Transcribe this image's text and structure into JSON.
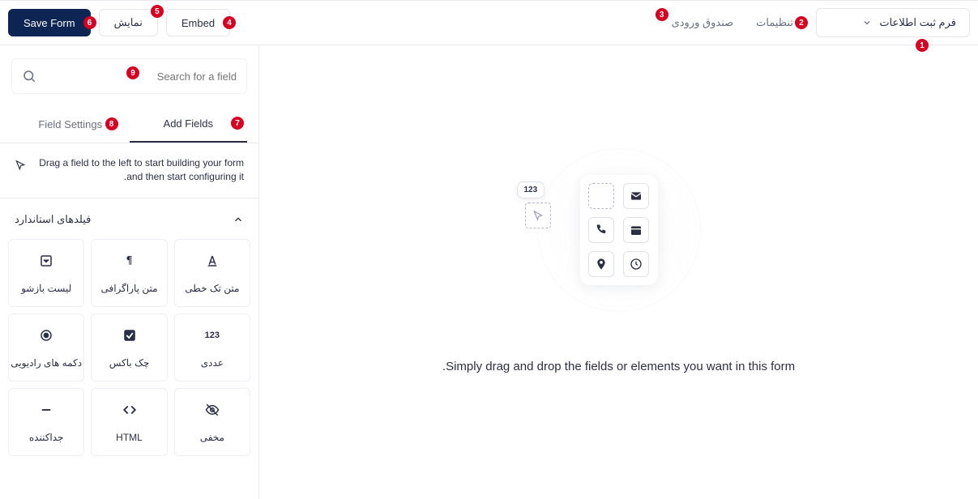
{
  "topbar": {
    "save_label": "Save Form",
    "preview_label": "نمایش",
    "embed_label": "Embed",
    "nav": {
      "inbox": "صندوق ورودی",
      "settings": "تنظیمات"
    },
    "form_name": "فرم ثبت اطلاعات"
  },
  "sidebar": {
    "search_placeholder": "Search for a field",
    "tabs": {
      "field_settings": "Field Settings",
      "add_fields": "Add Fields"
    },
    "hint": "Drag a field to the left to start building your form and then start configuring it.",
    "section_title": "فیلدهای استاندارد",
    "fields": [
      {
        "icon": "text-line",
        "label": "متن تک خطی"
      },
      {
        "icon": "paragraph",
        "label": "متن پاراگرافی"
      },
      {
        "icon": "dropdown",
        "label": "لیست بازشو"
      },
      {
        "icon": "numeric",
        "label": "عددی"
      },
      {
        "icon": "checkbox",
        "label": "چک باکس"
      },
      {
        "icon": "radio",
        "label": "دکمه های رادیویی"
      },
      {
        "icon": "hidden",
        "label": "مخفی"
      },
      {
        "icon": "html",
        "label": "HTML"
      },
      {
        "icon": "divider",
        "label": "جداکننده"
      }
    ]
  },
  "canvas": {
    "badge": "123",
    "message": "Simply drag and drop the fields or elements you want in this form."
  },
  "annotations": [
    "1",
    "2",
    "3",
    "4",
    "5",
    "6",
    "7",
    "8",
    "9"
  ]
}
